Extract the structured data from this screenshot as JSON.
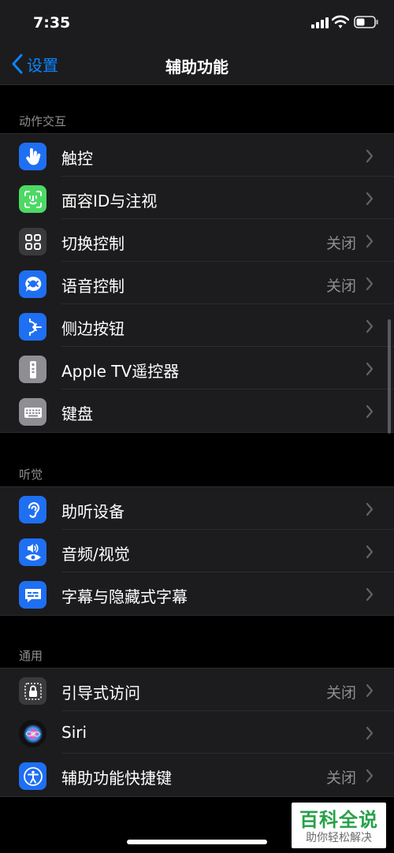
{
  "status_bar": {
    "time": "7:35"
  },
  "nav": {
    "back_label": "设置",
    "title": "辅助功能"
  },
  "sections": [
    {
      "header": "动作交互",
      "items": [
        {
          "label": "触控",
          "value": "",
          "icon": "hand-touch-icon",
          "icon_bg": "#1f6ff2"
        },
        {
          "label": "面容ID与注视",
          "value": "",
          "icon": "face-id-icon",
          "icon_bg": "#4cd964"
        },
        {
          "label": "切换控制",
          "value": "关闭",
          "icon": "switch-control-icon",
          "icon_bg": "#3a3a3c"
        },
        {
          "label": "语音控制",
          "value": "关闭",
          "icon": "voice-control-icon",
          "icon_bg": "#1f6ff2"
        },
        {
          "label": "侧边按钮",
          "value": "",
          "icon": "side-button-icon",
          "icon_bg": "#1f6ff2"
        },
        {
          "label": "Apple TV遥控器",
          "value": "",
          "icon": "tv-remote-icon",
          "icon_bg": "#8e8e93"
        },
        {
          "label": "键盘",
          "value": "",
          "icon": "keyboard-icon",
          "icon_bg": "#8e8e93"
        }
      ]
    },
    {
      "header": "听觉",
      "items": [
        {
          "label": "助听设备",
          "value": "",
          "icon": "ear-icon",
          "icon_bg": "#1f6ff2"
        },
        {
          "label": "音频/视觉",
          "value": "",
          "icon": "audio-visual-icon",
          "icon_bg": "#1f6ff2"
        },
        {
          "label": "字幕与隐藏式字幕",
          "value": "",
          "icon": "subtitles-icon",
          "icon_bg": "#1f6ff2"
        }
      ]
    },
    {
      "header": "通用",
      "items": [
        {
          "label": "引导式访问",
          "value": "关闭",
          "icon": "guided-access-lock-icon",
          "icon_bg": "#3a3a3c"
        },
        {
          "label": "Siri",
          "value": "",
          "icon": "siri-icon",
          "icon_bg": "#111111"
        },
        {
          "label": "辅助功能快捷键",
          "value": "关闭",
          "icon": "accessibility-icon",
          "icon_bg": "#1f6ff2"
        }
      ]
    }
  ],
  "watermark": {
    "title": "百科全说",
    "subtitle": "助你轻松解决"
  },
  "colors": {
    "accent": "#0a84ff",
    "background": "#000000",
    "cell": "#1c1c1e",
    "secondary_text": "#8e8e93"
  }
}
